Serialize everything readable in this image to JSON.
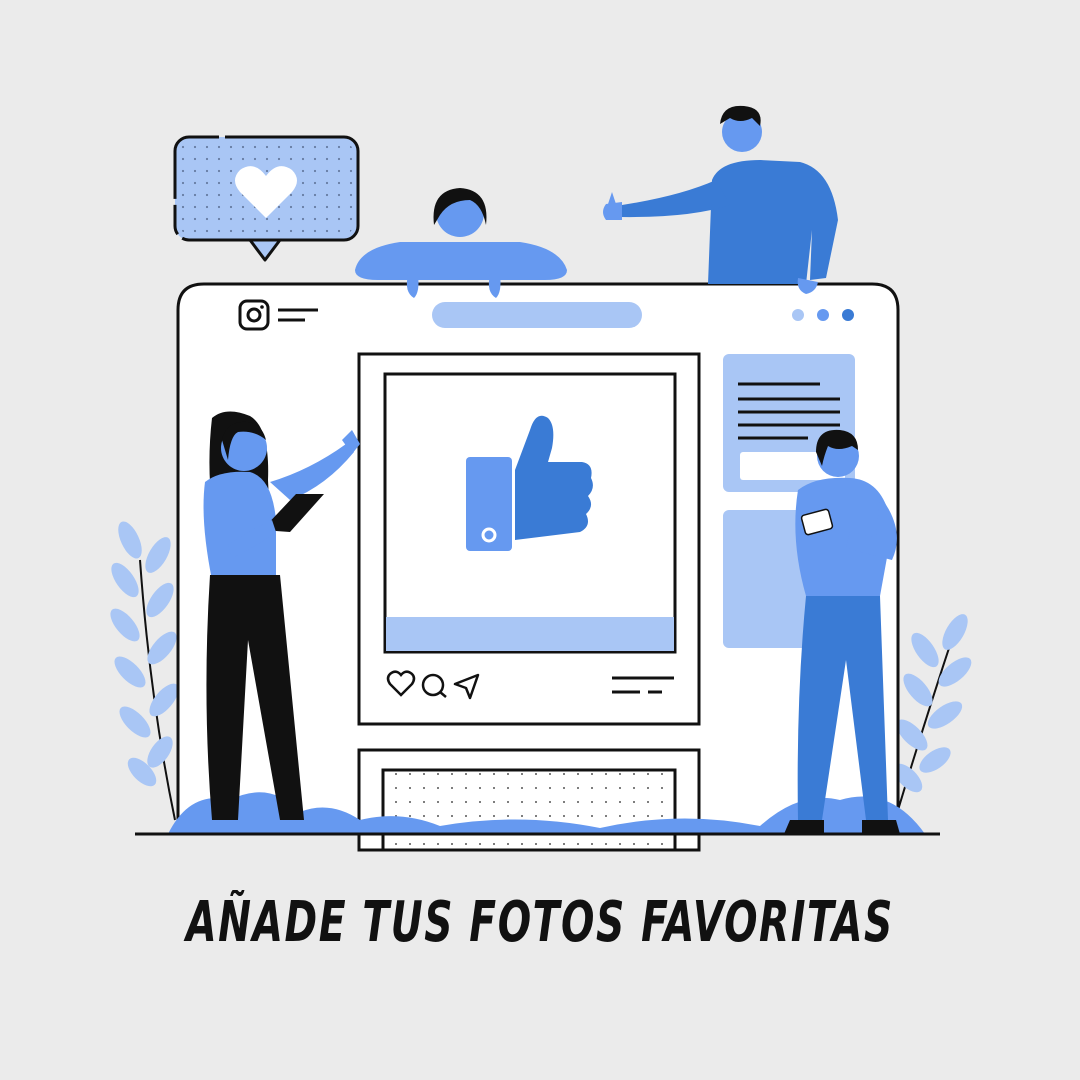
{
  "caption": "AÑADE TUS FOTOS FAVORITAS",
  "colors": {
    "background": "#ebebeb",
    "accent_dark": "#3a7bd5",
    "accent_mid": "#6699f0",
    "accent_light": "#a9c6f5",
    "ink": "#111111",
    "white": "#ffffff"
  },
  "icons": [
    "instagram-icon",
    "menu-lines-icon",
    "window-dots-icon",
    "heart-icon",
    "comment-icon",
    "share-icon",
    "thumbs-up-icon",
    "like-bubble-icon"
  ]
}
